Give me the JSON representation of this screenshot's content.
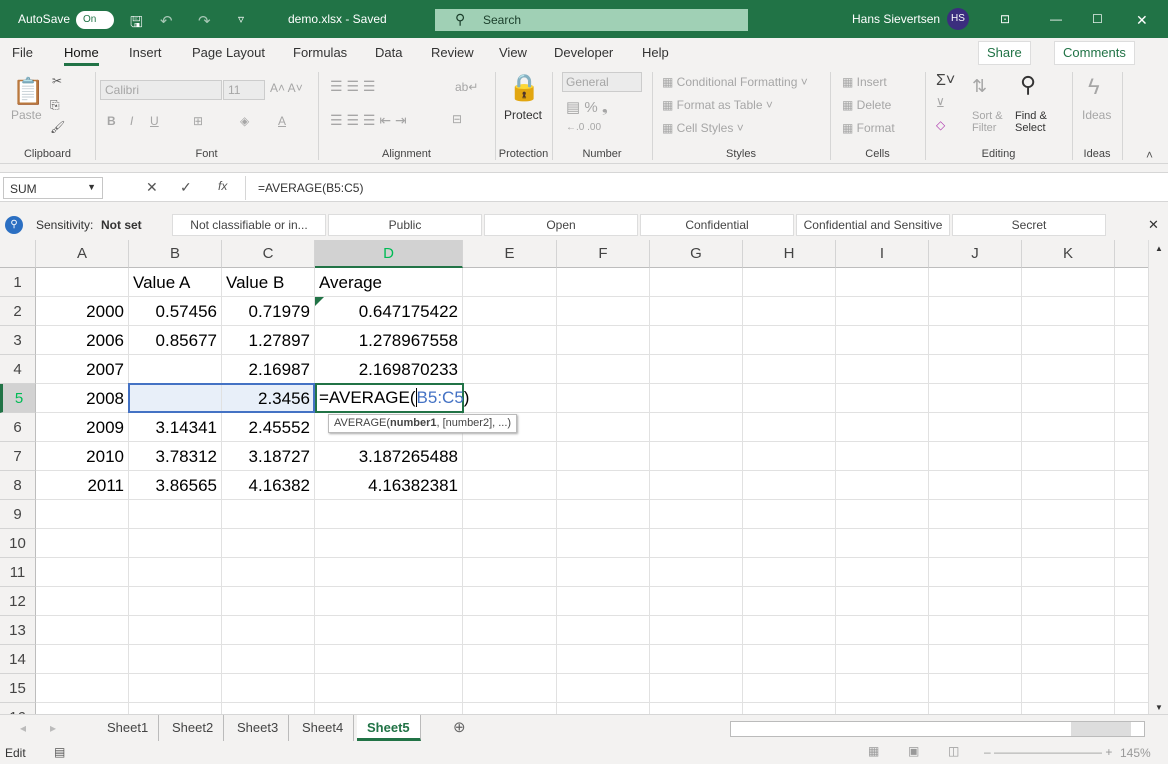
{
  "titlebar": {
    "autosave": "AutoSave",
    "toggle": "On",
    "filename": "demo.xlsx - Saved",
    "search": "Search",
    "user": "Hans Sievertsen",
    "initials": "HS"
  },
  "menu": [
    "File",
    "Home",
    "Insert",
    "Page Layout",
    "Formulas",
    "Data",
    "Review",
    "View",
    "Developer",
    "Help"
  ],
  "share": "Share",
  "comments": "Comments",
  "ribbon": {
    "groups": [
      "Clipboard",
      "Font",
      "Alignment",
      "Protection",
      "Number",
      "Styles",
      "Cells",
      "Editing",
      "Ideas"
    ],
    "paste": "Paste",
    "font": "Calibri",
    "size": "11",
    "protect": "Protect",
    "number_format": "General",
    "styles": [
      "Conditional Formatting",
      "Format as Table",
      "Cell Styles"
    ],
    "cells": [
      "Insert",
      "Delete",
      "Format"
    ],
    "sort": "Sort & Filter",
    "find": "Find & Select",
    "ideas": "Ideas"
  },
  "formula_bar": {
    "name_box": "SUM",
    "formula": "=AVERAGE(B5:C5)"
  },
  "sensitivity": {
    "label": "Sensitivity:",
    "value": "Not set",
    "options": [
      "Not classifiable or in...",
      "Public",
      "Open",
      "Confidential",
      "Confidential and Sensitive",
      "Secret"
    ]
  },
  "columns": [
    "A",
    "B",
    "C",
    "D",
    "E",
    "F",
    "G",
    "H",
    "I",
    "J",
    "K"
  ],
  "rows": [
    [
      "",
      "Value A",
      "Value B",
      "Average"
    ],
    [
      "2000",
      "0.57456",
      "0.71979",
      "0.647175422"
    ],
    [
      "2006",
      "0.85677",
      "1.27897",
      "1.278967558"
    ],
    [
      "2007",
      "",
      "2.16987",
      "2.169870233"
    ],
    [
      "2008",
      "",
      "2.3456",
      ""
    ],
    [
      "2009",
      "3.14341",
      "2.45552",
      "2.455521841"
    ],
    [
      "2010",
      "3.78312",
      "3.18727",
      "3.187265488"
    ],
    [
      "2011",
      "3.86565",
      "4.16382",
      "4.16382381"
    ]
  ],
  "editing": {
    "prefix": "=AVERAGE(",
    "ref": "B5:C5",
    "suffix": ")",
    "tooltip_fn": "AVERAGE(",
    "tooltip_bold": "number1",
    "tooltip_rest": ", [number2], ...)"
  },
  "sheets": [
    "Sheet1",
    "Sheet2",
    "Sheet3",
    "Sheet4",
    "Sheet5"
  ],
  "active_sheet": "Sheet5",
  "status": {
    "mode": "Edit",
    "zoom": "145%"
  },
  "colors": {
    "brand": "#217346",
    "ref": "#4472c4"
  }
}
